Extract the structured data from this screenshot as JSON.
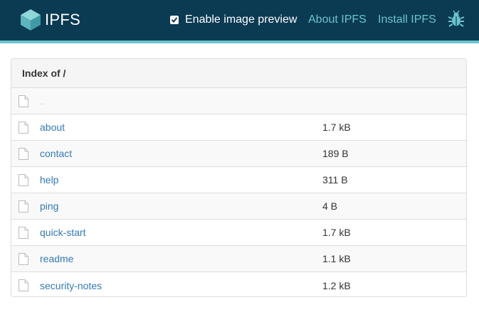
{
  "header": {
    "logo_text": "IPFS",
    "preview_label": "Enable image preview",
    "preview_checked": true,
    "about_link": "About IPFS",
    "install_link": "Install IPFS",
    "bug_icon": "bug-icon",
    "colors": {
      "header_bg": "#0b3a53",
      "accent": "#69c4cd",
      "link": "#337ab7"
    }
  },
  "listing": {
    "title": "Index of /",
    "parent": "..",
    "files": [
      {
        "name": "about",
        "size": "1.7 kB"
      },
      {
        "name": "contact",
        "size": "189 B"
      },
      {
        "name": "help",
        "size": "311 B"
      },
      {
        "name": "ping",
        "size": "4 B"
      },
      {
        "name": "quick-start",
        "size": "1.7 kB"
      },
      {
        "name": "readme",
        "size": "1.1 kB"
      },
      {
        "name": "security-notes",
        "size": "1.2 kB"
      }
    ]
  }
}
